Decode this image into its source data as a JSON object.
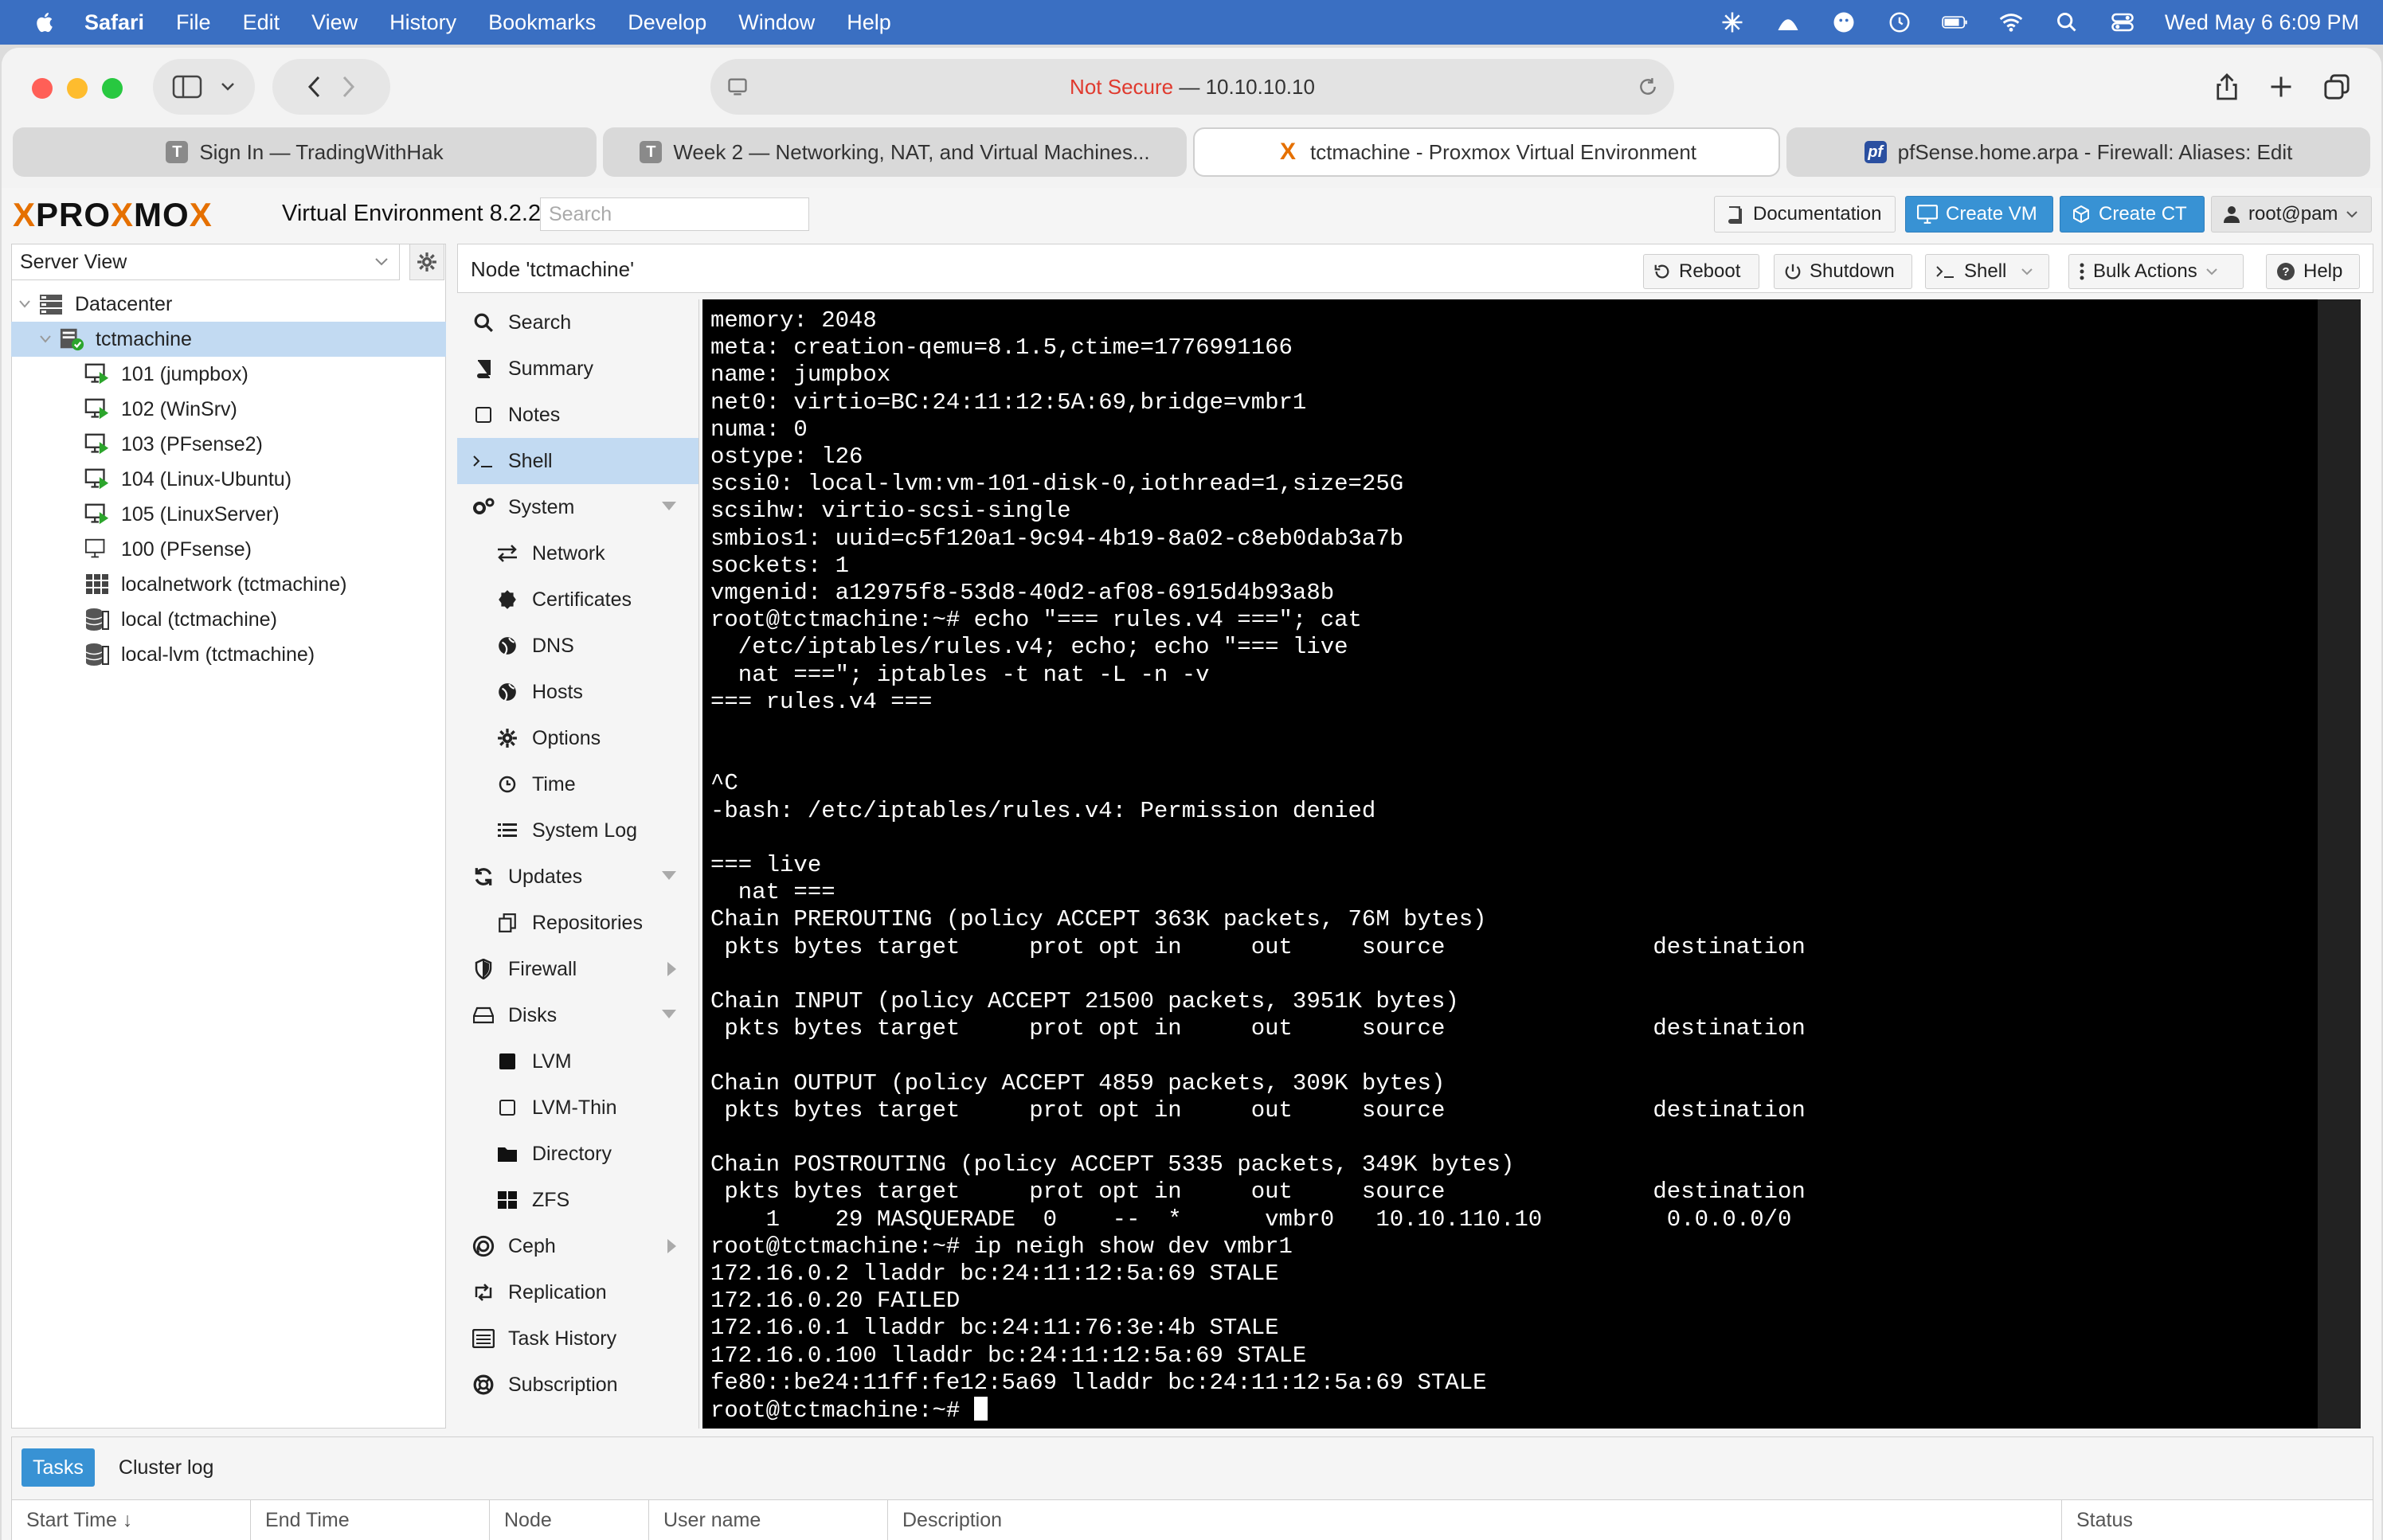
{
  "menubar": {
    "app": "Safari",
    "items": [
      "File",
      "Edit",
      "View",
      "History",
      "Bookmarks",
      "Develop",
      "Window",
      "Help"
    ],
    "clock": "Wed May 6  6:09 PM"
  },
  "safari": {
    "address": {
      "not_secure": "Not Secure",
      "separator": " — ",
      "host": "10.10.10.10"
    },
    "tabs": [
      {
        "label": "Sign In — TradingWithHak",
        "favicon": "T"
      },
      {
        "label": "Week 2 — Networking, NAT, and Virtual Machines...",
        "favicon": "T"
      },
      {
        "label": "tctmachine - Proxmox Virtual Environment",
        "favicon": "X"
      },
      {
        "label": "pfSense.home.arpa - Firewall: Aliases: Edit",
        "favicon": "pf"
      }
    ]
  },
  "pve": {
    "logo": {
      "pro": "PRO",
      "x": "X",
      "mo": "MO",
      "x2": "X"
    },
    "version": "Virtual Environment 8.2.2",
    "search_placeholder": "Search",
    "header_buttons": {
      "documentation": "Documentation",
      "create_vm": "Create VM",
      "create_ct": "Create CT",
      "user": "root@pam"
    },
    "view_selector": "Server View",
    "tree": {
      "datacenter": "Datacenter",
      "node": "tctmachine",
      "children": [
        {
          "label": "101 (jumpbox)",
          "type": "vm-running"
        },
        {
          "label": "102 (WinSrv)",
          "type": "vm-running"
        },
        {
          "label": "103 (PFsense2)",
          "type": "vm-running"
        },
        {
          "label": "104 (Linux-Ubuntu)",
          "type": "vm-running"
        },
        {
          "label": "105 (LinuxServer)",
          "type": "vm-running"
        },
        {
          "label": "100 (PFsense)",
          "type": "vm-stopped"
        },
        {
          "label": "localnetwork (tctmachine)",
          "type": "network"
        },
        {
          "label": "local (tctmachine)",
          "type": "storage"
        },
        {
          "label": "local-lvm (tctmachine)",
          "type": "storage"
        }
      ]
    },
    "node_panel": {
      "title": "Node 'tctmachine'",
      "buttons": {
        "reboot": "Reboot",
        "shutdown": "Shutdown",
        "shell": "Shell",
        "bulk_actions": "Bulk Actions",
        "help": "Help"
      }
    },
    "nav": [
      {
        "label": "Search",
        "icon": "search-icon",
        "level": 0
      },
      {
        "label": "Summary",
        "icon": "book-icon",
        "level": 0
      },
      {
        "label": "Notes",
        "icon": "note-icon",
        "level": 0
      },
      {
        "label": "Shell",
        "icon": "terminal-icon",
        "level": 0,
        "selected": true
      },
      {
        "label": "System",
        "icon": "gears-icon",
        "level": 0,
        "arrow": "down"
      },
      {
        "label": "Network",
        "icon": "exchange-icon",
        "level": 1
      },
      {
        "label": "Certificates",
        "icon": "certificate-icon",
        "level": 1
      },
      {
        "label": "DNS",
        "icon": "globe-icon",
        "level": 1
      },
      {
        "label": "Hosts",
        "icon": "globe-icon",
        "level": 1
      },
      {
        "label": "Options",
        "icon": "gear-icon",
        "level": 1
      },
      {
        "label": "Time",
        "icon": "clock-icon",
        "level": 1
      },
      {
        "label": "System Log",
        "icon": "list-icon",
        "level": 1
      },
      {
        "label": "Updates",
        "icon": "refresh-icon",
        "level": 0,
        "arrow": "down"
      },
      {
        "label": "Repositories",
        "icon": "files-icon",
        "level": 1
      },
      {
        "label": "Firewall",
        "icon": "shield-icon",
        "level": 0,
        "arrow": "right"
      },
      {
        "label": "Disks",
        "icon": "hdd-icon",
        "level": 0,
        "arrow": "down"
      },
      {
        "label": "LVM",
        "icon": "square-icon",
        "level": 1
      },
      {
        "label": "LVM-Thin",
        "icon": "square-outline-icon",
        "level": 1
      },
      {
        "label": "Directory",
        "icon": "folder-icon",
        "level": 1
      },
      {
        "label": "ZFS",
        "icon": "th-large-icon",
        "level": 1
      },
      {
        "label": "Ceph",
        "icon": "ceph-icon",
        "level": 0,
        "arrow": "right"
      },
      {
        "label": "Replication",
        "icon": "retweet-icon",
        "level": 0
      },
      {
        "label": "Task History",
        "icon": "tasklist-icon",
        "level": 0
      },
      {
        "label": "Subscription",
        "icon": "support-icon",
        "level": 0
      }
    ],
    "terminal_lines": [
      "memory: 2048",
      "meta: creation-qemu=8.1.5,ctime=1776991166",
      "name: jumpbox",
      "net0: virtio=BC:24:11:12:5A:69,bridge=vmbr1",
      "numa: 0",
      "ostype: l26",
      "scsi0: local-lvm:vm-101-disk-0,iothread=1,size=25G",
      "scsihw: virtio-scsi-single",
      "smbios1: uuid=c5f120a1-9c94-4b19-8a02-c8eb0dab3a7b",
      "sockets: 1",
      "vmgenid: a12975f8-53d8-40d2-af08-6915d4b93a8b",
      "root@tctmachine:~# echo \"=== rules.v4 ===\"; cat",
      "  /etc/iptables/rules.v4; echo; echo \"=== live",
      "  nat ===\"; iptables -t nat -L -n -v",
      "=== rules.v4 ===",
      "",
      "",
      "^C",
      "-bash: /etc/iptables/rules.v4: Permission denied",
      "",
      "=== live",
      "  nat ===",
      "Chain PREROUTING (policy ACCEPT 363K packets, 76M bytes)",
      " pkts bytes target     prot opt in     out     source               destination",
      "",
      "Chain INPUT (policy ACCEPT 21500 packets, 3951K bytes)",
      " pkts bytes target     prot opt in     out     source               destination",
      "",
      "Chain OUTPUT (policy ACCEPT 4859 packets, 309K bytes)",
      " pkts bytes target     prot opt in     out     source               destination",
      "",
      "Chain POSTROUTING (policy ACCEPT 5335 packets, 349K bytes)",
      " pkts bytes target     prot opt in     out     source               destination",
      "    1    29 MASQUERADE  0    --  *      vmbr0   10.10.110.10         0.0.0.0/0",
      "root@tctmachine:~# ip neigh show dev vmbr1",
      "172.16.0.2 lladdr bc:24:11:12:5a:69 STALE",
      "172.16.0.20 FAILED",
      "172.16.0.1 lladdr bc:24:11:76:3e:4b STALE",
      "172.16.0.100 lladdr bc:24:11:12:5a:69 STALE",
      "fe80::be24:11ff:fe12:5a69 lladdr bc:24:11:12:5a:69 STALE",
      "root@tctmachine:~# "
    ],
    "bottom": {
      "tabs": [
        "Tasks",
        "Cluster log"
      ],
      "columns": [
        "Start Time ↓",
        "End Time",
        "Node",
        "User name",
        "Description",
        "Status"
      ]
    }
  },
  "colors": {
    "menubar": "#3a6fc2",
    "pve_blue": "#3892d4",
    "selected": "#c2daf2",
    "running_green": "#2ca52c",
    "not_secure": "#e03a2e",
    "logo_orange": "#e57000"
  }
}
